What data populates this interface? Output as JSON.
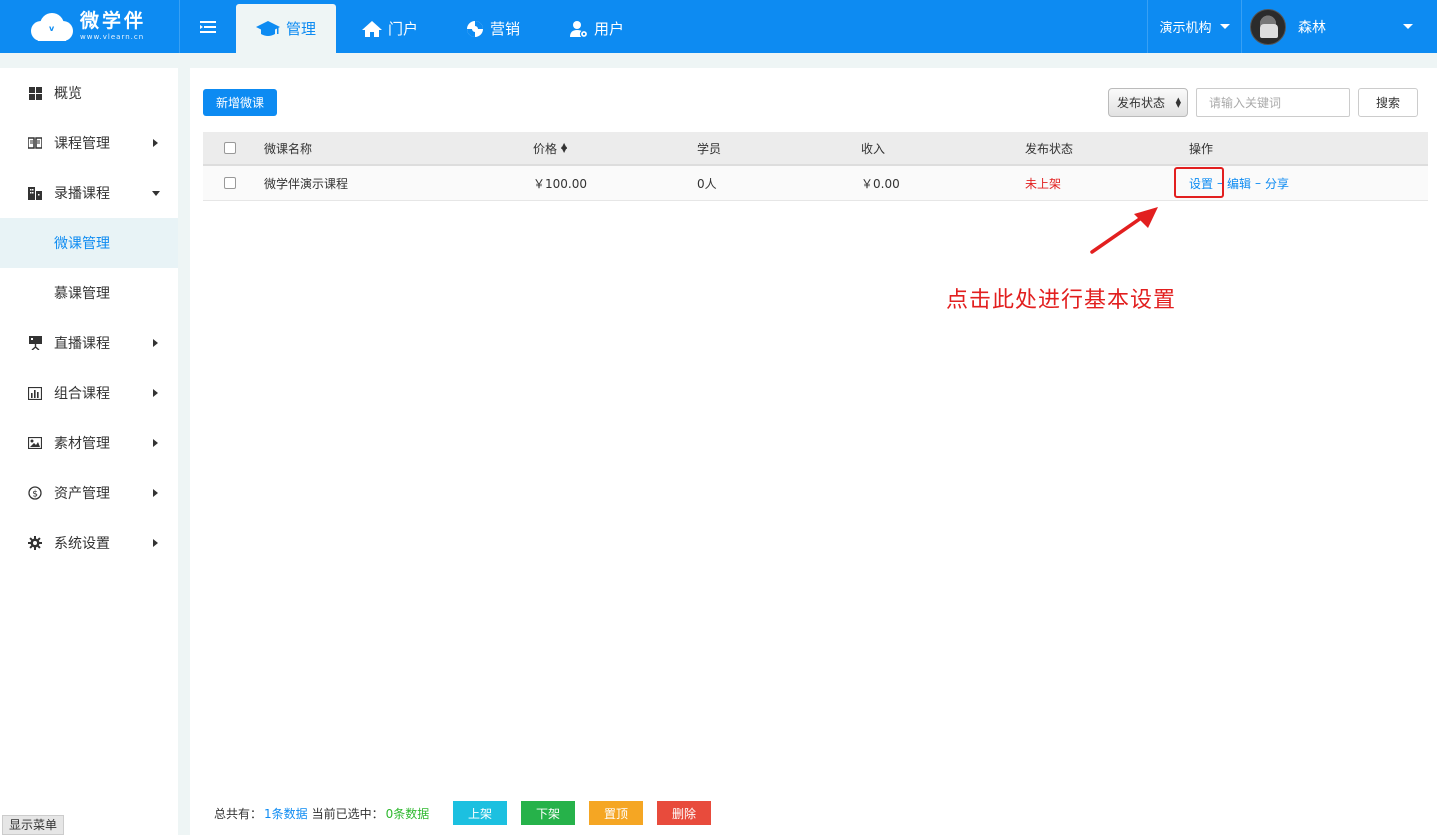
{
  "brand": {
    "name": "微学伴",
    "url": "www.vlearn.cn",
    "color": "#0d8bf2"
  },
  "topnav": {
    "tabs": [
      {
        "label": "管理",
        "icon": "graduation-cap-icon",
        "active": true
      },
      {
        "label": "门户",
        "icon": "home-icon",
        "active": false
      },
      {
        "label": "营销",
        "icon": "spinner-icon",
        "active": false
      },
      {
        "label": "用户",
        "icon": "user-gear-icon",
        "active": false
      }
    ],
    "org": "演示机构",
    "user_name": "森林"
  },
  "sidebar": {
    "items": [
      {
        "label": "概览",
        "icon": "grid-icon"
      },
      {
        "label": "课程管理",
        "icon": "book-icon"
      },
      {
        "label": "录播课程",
        "icon": "building-icon"
      },
      {
        "label": "直播课程",
        "icon": "presentation-icon"
      },
      {
        "label": "组合课程",
        "icon": "bar-chart-icon"
      },
      {
        "label": "素材管理",
        "icon": "image-icon"
      },
      {
        "label": "资产管理",
        "icon": "dollar-icon"
      },
      {
        "label": "系统设置",
        "icon": "gear-icon"
      }
    ],
    "subitems": [
      {
        "label": "微课管理",
        "active": true
      },
      {
        "label": "慕课管理",
        "active": false
      }
    ],
    "show_menu": "显示菜单"
  },
  "toolbar": {
    "add_label": "新增微课",
    "status_filter": "发布状态",
    "search_placeholder": "请输入关键词",
    "search_label": "搜索"
  },
  "table": {
    "columns": [
      "微课名称",
      "价格",
      "学员",
      "收入",
      "发布状态",
      "操作"
    ],
    "rows": [
      {
        "name": "微学伴演示课程",
        "price": "￥100.00",
        "students": "0人",
        "income": "￥0.00",
        "status": "未上架",
        "actions": {
          "settings": "设置",
          "edit": "编辑",
          "share": "分享",
          "sep": "–"
        }
      }
    ]
  },
  "annotation": "点击此处进行基本设置",
  "footer": {
    "total_prefix": "总共有：",
    "total_value": "1条数据",
    "selected_prefix": "当前已选中：",
    "selected_value": "0条数据",
    "buttons": [
      {
        "label": "上架",
        "color": "#1cc0e0"
      },
      {
        "label": "下架",
        "color": "#26b24a"
      },
      {
        "label": "置顶",
        "color": "#f5a623"
      },
      {
        "label": "删除",
        "color": "#e84b3c"
      }
    ]
  }
}
